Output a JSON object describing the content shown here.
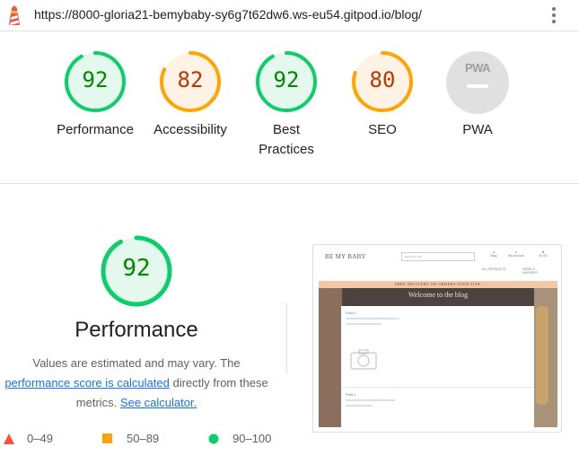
{
  "url": "https://8000-gloria21-bemybaby-sy6g7t62dw6.ws-eu54.gitpod.io/blog/",
  "colors": {
    "pass": "#0cce6b",
    "pass_text": "#008800",
    "average": "#ffa400",
    "average_text": "#c33300",
    "fail": "#ff4e42",
    "link": "#1a73e8"
  },
  "gauges": [
    {
      "label": "Performance",
      "score": "92",
      "value": 0.92,
      "rating": "pass"
    },
    {
      "label": "Accessibility",
      "score": "82",
      "value": 0.82,
      "rating": "average"
    },
    {
      "label": "Best Practices",
      "score": "92",
      "value": 0.92,
      "rating": "pass"
    },
    {
      "label": "SEO",
      "score": "80",
      "value": 0.8,
      "rating": "average"
    },
    {
      "label": "PWA",
      "score": "PWA",
      "value": 0,
      "rating": "na"
    }
  ],
  "performance": {
    "score": "92",
    "value": 0.92,
    "title": "Performance",
    "desc_1": "Values are estimated and may vary. The",
    "desc_link": "performance score is calculated",
    "desc_2": "directly from these metrics.",
    "calc_link": "See calculator."
  },
  "legend": [
    {
      "range": "0–49",
      "icon": "triangle-icon",
      "color": "#ff4e42"
    },
    {
      "range": "50–89",
      "icon": "square-icon",
      "color": "#ffa400"
    },
    {
      "range": "90–100",
      "icon": "circle-icon",
      "color": "#0cce6b"
    }
  ],
  "thumbnail": {
    "site_name": "BE MY BABY",
    "search_placeholder": "Search our site",
    "nav": [
      "Blog",
      "My Account",
      "£0.00"
    ],
    "menu": [
      "ALL PRODUCTS",
      "HOME & NURSERY"
    ],
    "banner": "FREE DELIVERY ON ORDERS OVER £100!",
    "hero_title": "Welcome to the blog",
    "post_1": "Post 0",
    "post_2": "Post 1"
  }
}
